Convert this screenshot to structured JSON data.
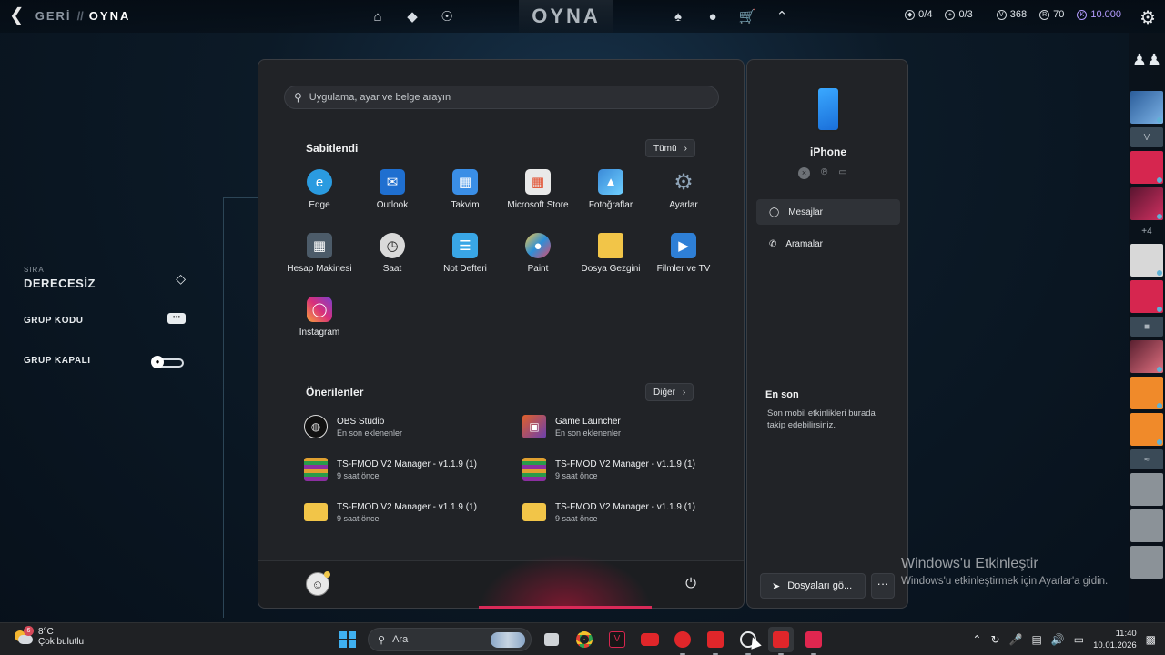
{
  "game": {
    "back": {
      "label_muted": "GERİ",
      "separator": "//",
      "label": "OYNA"
    },
    "nav": {
      "title": "OYNA",
      "left_icons": [
        "home-icon",
        "career-icon",
        "agents-icon"
      ],
      "right_icons": [
        "battlepass-icon",
        "collection-icon",
        "store-icon",
        "rank-icon"
      ]
    },
    "currency": {
      "quest": "0/4",
      "challenge": "0/3",
      "valorant_points": "368",
      "radianite": "70",
      "kingdom_credits": "10.000"
    },
    "left_panel": {
      "rank_caption": "SIRA",
      "rank_value": "DERECESİZ",
      "group_code": "GRUP KODU",
      "group_closed": "GRUP KAPALI"
    },
    "social": {
      "more_count": "+4"
    }
  },
  "start_menu": {
    "search_placeholder": "Uygulama, ayar ve belge arayın",
    "pinned_title": "Sabitlendi",
    "all_button": "Tümü",
    "pinned": [
      {
        "label": "Edge",
        "icon": "edge-icon",
        "color": "#2a9be0"
      },
      {
        "label": "Outlook",
        "icon": "outlook-icon",
        "color": "#1f6fd0"
      },
      {
        "label": "Takvim",
        "icon": "calendar-icon",
        "color": "#3a8ee6"
      },
      {
        "label": "Microsoft Store",
        "icon": "store-icon",
        "color": "#e9e9e9"
      },
      {
        "label": "Fotoğraflar",
        "icon": "photos-icon",
        "color": "#3a8ad8"
      },
      {
        "label": "Ayarlar",
        "icon": "settings-icon",
        "color": "#6b7a88"
      },
      {
        "label": "Hesap Makinesi",
        "icon": "calculator-icon",
        "color": "#4c5b69"
      },
      {
        "label": "Saat",
        "icon": "clock-icon",
        "color": "#d9d9d9"
      },
      {
        "label": "Not Defteri",
        "icon": "notepad-icon",
        "color": "#39a6e6"
      },
      {
        "label": "Paint",
        "icon": "paint-icon",
        "color": "#2d8fd8"
      },
      {
        "label": "Dosya Gezgini",
        "icon": "folder-icon",
        "color": "#f2c548"
      },
      {
        "label": "Filmler ve TV",
        "icon": "movies-icon",
        "color": "#2e7fd6"
      },
      {
        "label": "Instagram",
        "icon": "instagram-icon",
        "color": "#d9307a"
      }
    ],
    "recommended_title": "Önerilenler",
    "more_button": "Diğer",
    "recommended": [
      {
        "title": "OBS Studio",
        "subtitle": "En son eklenenler",
        "icon": "obs-icon",
        "color": "#2a2a2a"
      },
      {
        "title": "Game Launcher",
        "subtitle": "En son eklenenler",
        "icon": "game-launcher-icon",
        "color": "#6a3fb0"
      },
      {
        "title": "TS-FMOD V2 Manager - v1.1.9 (1)",
        "subtitle": "9 saat önce",
        "icon": "winrar-icon",
        "color": "#8b2fa0"
      },
      {
        "title": "TS-FMOD V2 Manager - v1.1.9 (1)",
        "subtitle": "9 saat önce",
        "icon": "winrar-icon",
        "color": "#8b2fa0"
      },
      {
        "title": "TS-FMOD V2 Manager - v1.1.9 (1)",
        "subtitle": "9 saat önce",
        "icon": "folder-icon",
        "color": "#f2c548"
      },
      {
        "title": "TS-FMOD V2 Manager - v1.1.9 (1)",
        "subtitle": "9 saat önce",
        "icon": "folder-icon",
        "color": "#f2c548"
      }
    ]
  },
  "phone_link": {
    "device_name": "iPhone",
    "messages": "Mesajlar",
    "calls": "Aramalar",
    "recent_title": "En son",
    "recent_desc": "Son mobil etkinlikleri burada takip edebilirsiniz.",
    "send_files": "Dosyaları gö...",
    "more": "···"
  },
  "watermark": {
    "title": "Windows'u Etkinleştir",
    "desc": "Windows'u etkinleştirmek için Ayarlar'a gidin."
  },
  "taskbar": {
    "weather_badge": "6",
    "temperature": "8°C",
    "condition": "Çok bulutlu",
    "search_label": "Ara",
    "time": "11:40",
    "date": "10.01.2026"
  }
}
